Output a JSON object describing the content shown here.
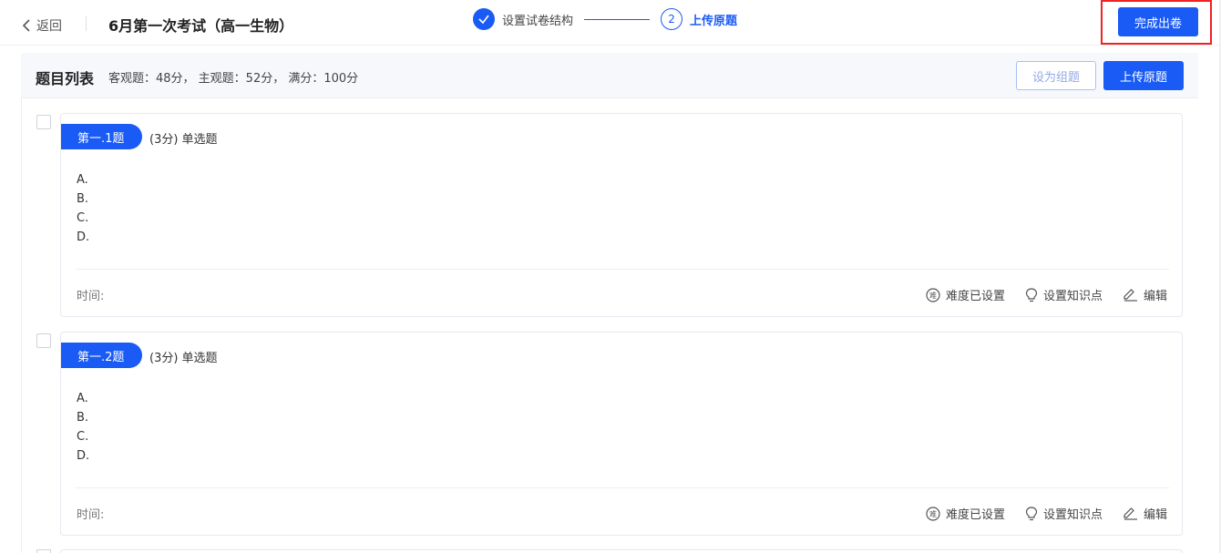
{
  "header": {
    "back_label": "返回",
    "exam_title": "6月第一次考试（高一生物）",
    "steps": [
      {
        "label": "设置试卷结构",
        "status": "done"
      },
      {
        "num": "2",
        "label": "上传原题",
        "status": "active"
      }
    ],
    "finish_label": "完成出卷"
  },
  "toolbar": {
    "title": "题目列表",
    "score_info": "客观题：48分， 主观题：52分， 满分：100分",
    "group_label": "设为组题",
    "upload_label": "上传原题"
  },
  "questions": [
    {
      "tag": "第一.1题",
      "meta": "(3分) 单选题",
      "options": [
        "A.",
        "B.",
        "C.",
        "D."
      ],
      "time_label": "时间:",
      "actions": [
        "难度已设置",
        "设置知识点",
        "编辑"
      ]
    },
    {
      "tag": "第一.2题",
      "meta": "(3分) 单选题",
      "options": [
        "A.",
        "B.",
        "C.",
        "D."
      ],
      "time_label": "时间:",
      "actions": [
        "难度已设置",
        "设置知识点",
        "编辑"
      ]
    }
  ],
  "icons": {
    "back": "chevron-left-icon",
    "step_done": "check-icon",
    "difficulty": "difficulty-icon",
    "knowledge": "lightbulb-icon",
    "edit": "edit-icon",
    "difficulty_glyph": "难"
  },
  "colors": {
    "primary": "#1a5bf5",
    "highlight_border": "#f02222"
  }
}
